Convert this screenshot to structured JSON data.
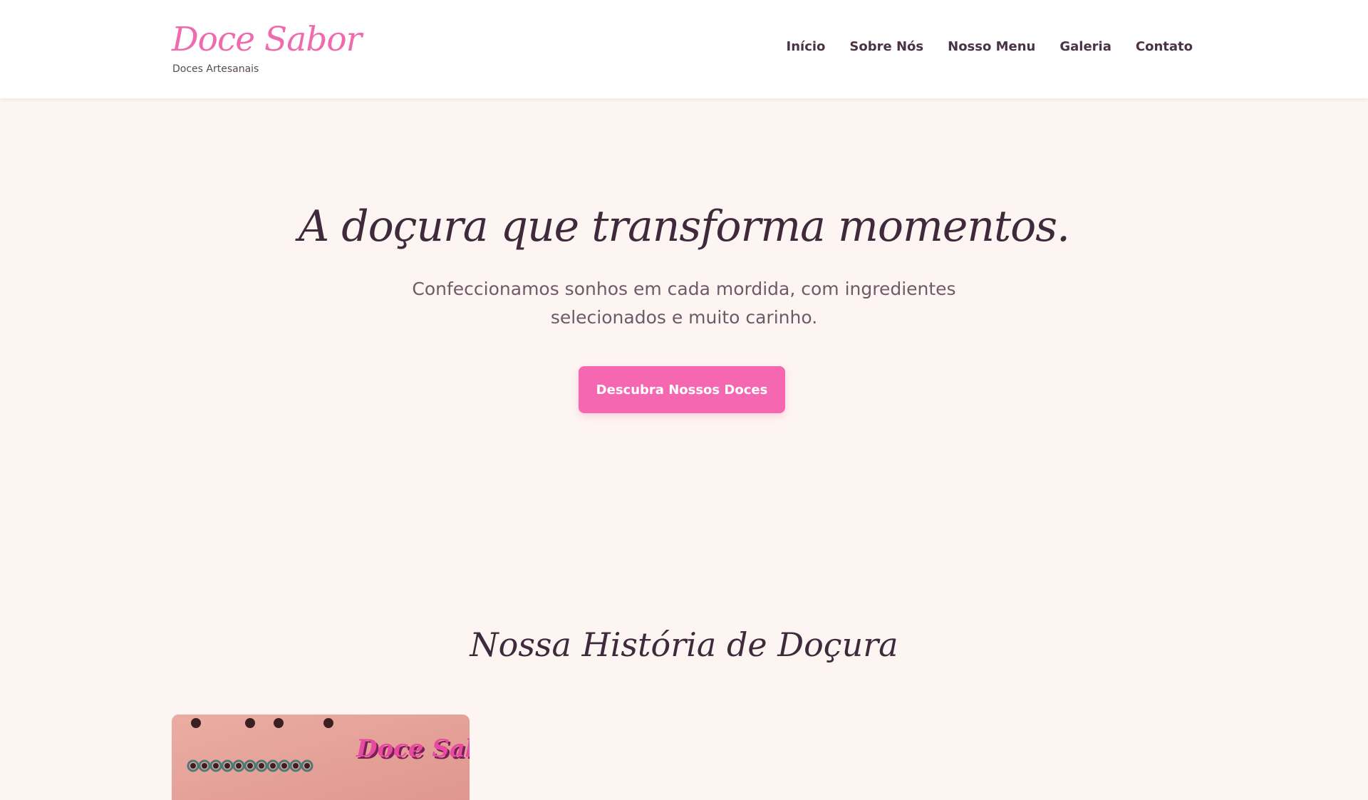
{
  "brand": {
    "name": "Doce Sabor",
    "tagline": "Doces Artesanais"
  },
  "nav": {
    "items": [
      {
        "label": "Início"
      },
      {
        "label": "Sobre Nós"
      },
      {
        "label": "Nosso Menu"
      },
      {
        "label": "Galeria"
      },
      {
        "label": "Contato"
      }
    ]
  },
  "hero": {
    "title": "A doçura que transforma momentos.",
    "subtitle": "Confeccionamos sonhos em cada mordida, com ingredientes selecionados e muito carinho.",
    "cta_label": "Descubra Nossos Doces"
  },
  "history": {
    "title": "Nossa História de Doçura",
    "image_logo_text": "Doce Sabor"
  },
  "colors": {
    "accent": "#f567b1",
    "brand": "#f06aae",
    "heading": "#3f2a3b",
    "background": "#fdf5f2"
  }
}
